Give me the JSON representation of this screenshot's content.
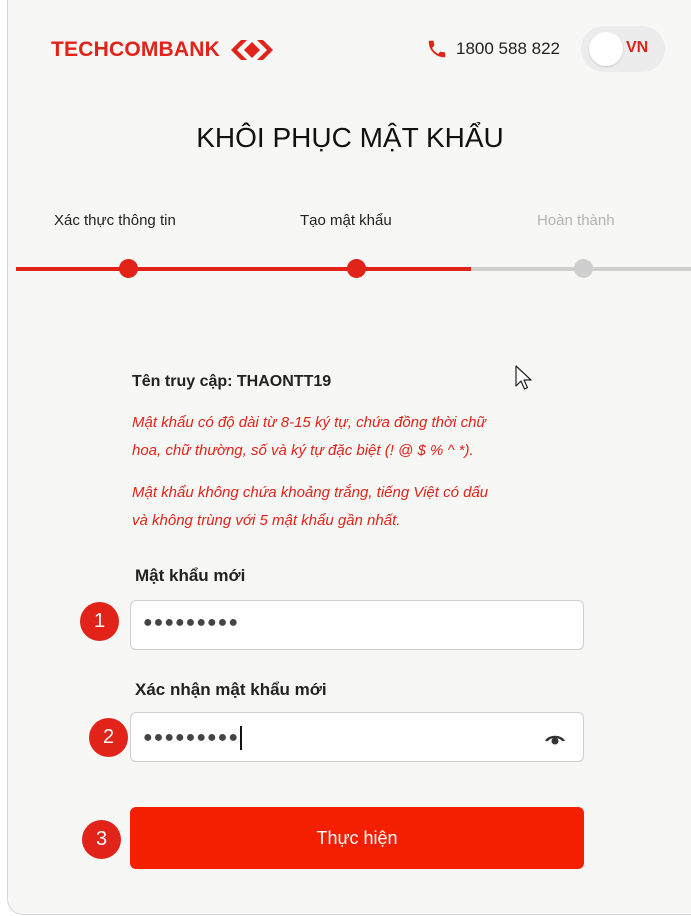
{
  "header": {
    "brand": "TECHCOMBANK",
    "phone_icon": "phone-icon",
    "phone": "1800 588 822",
    "language": "VN"
  },
  "page": {
    "title": "KHÔI PHỤC MẬT KHẨU"
  },
  "steps": [
    {
      "label": "Xác thực thông tin",
      "state": "completed"
    },
    {
      "label": "Tạo mật khẩu",
      "state": "current"
    },
    {
      "label": "Hoàn thành",
      "state": "pending"
    }
  ],
  "form": {
    "username_line": "Tên truy cập: THAONTT19",
    "rule_1_line_1": "Mật khẩu có độ dài từ 8-15 ký tự, chứa đồng thời chữ",
    "rule_1_line_2": "hoa, chữ thường, số và ký tự đặc biệt (! @ $ % ^ *).",
    "rule_2_line_1": "Mật khẩu không chứa khoảng trắng, tiếng Việt có dấu",
    "rule_2_line_2": "và không trùng với 5 mật khẩu gần nhất.",
    "new_password_label": "Mật khẩu mới",
    "new_password_value": "●●●●●●●●●",
    "confirm_password_label": "Xác nhận mật khẩu mới",
    "confirm_password_value": "●●●●●●●●●",
    "eye_icon": "eye-icon",
    "submit_label": "Thực hiện"
  },
  "annotations": {
    "badge_1": "1",
    "badge_2": "2",
    "badge_3": "3"
  },
  "colors": {
    "brand_red": "#e2231a",
    "button_red": "#f41f00",
    "inactive_gray": "#cfcfcf"
  }
}
